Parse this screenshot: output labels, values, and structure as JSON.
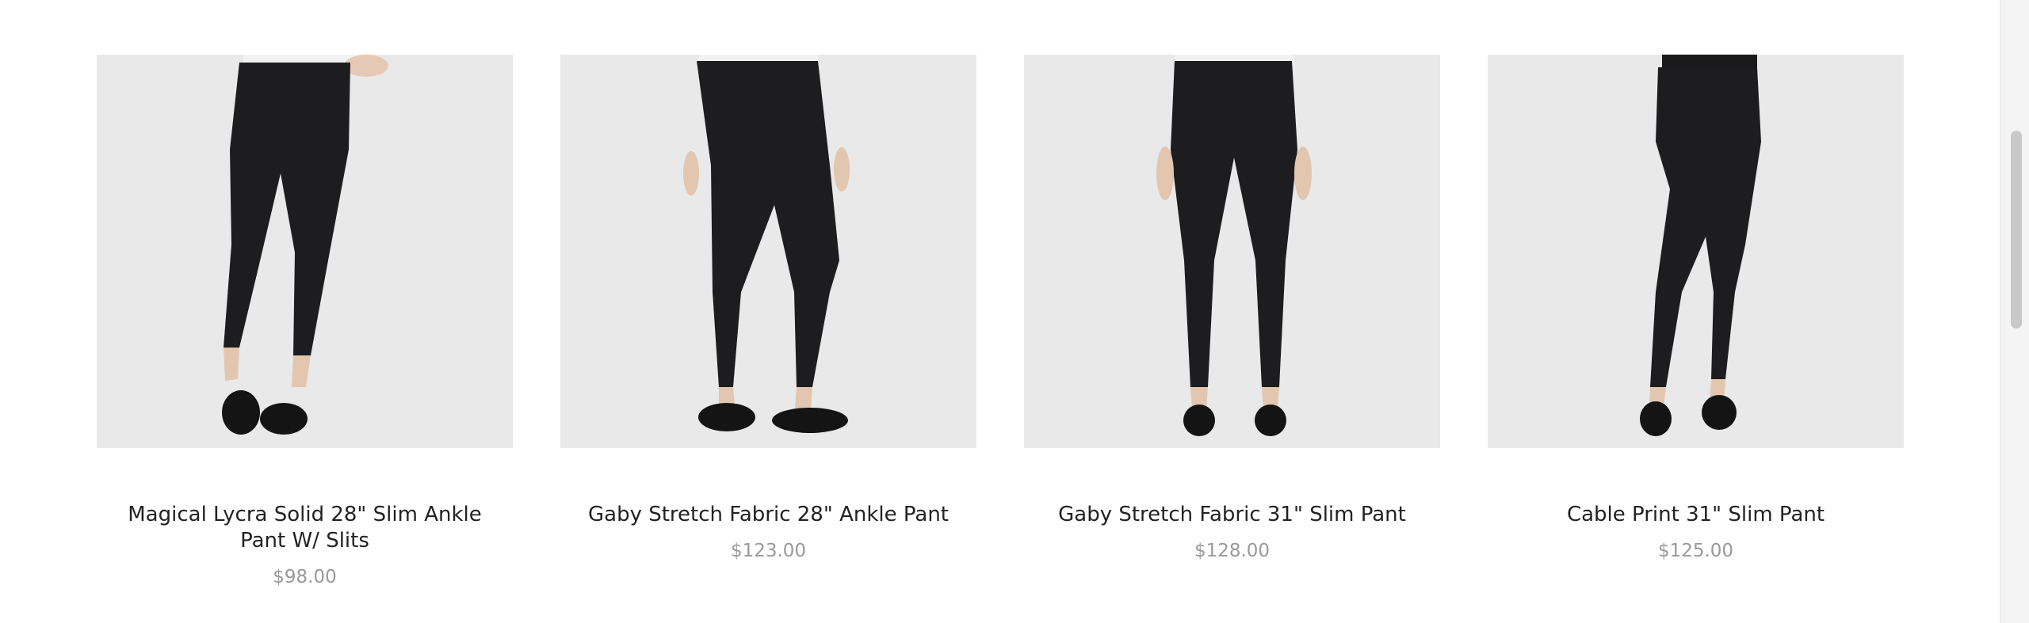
{
  "products": [
    {
      "title": "Magical Lycra Solid 28\" Slim Ankle Pant W/ Slits",
      "price": "$98.00",
      "image_icon": "pants-product-image"
    },
    {
      "title": "Gaby Stretch Fabric 28\" Ankle Pant",
      "price": "$123.00",
      "image_icon": "pants-product-image"
    },
    {
      "title": "Gaby Stretch Fabric 31\" Slim Pant",
      "price": "$128.00",
      "image_icon": "pants-product-image"
    },
    {
      "title": "Cable Print 31\" Slim Pant",
      "price": "$125.00",
      "image_icon": "pants-product-image"
    }
  ],
  "colors": {
    "image_bg": "#e9e9e9",
    "title_text": "#222222",
    "price_text": "#999999",
    "pant_fabric": "#1d1d20"
  }
}
